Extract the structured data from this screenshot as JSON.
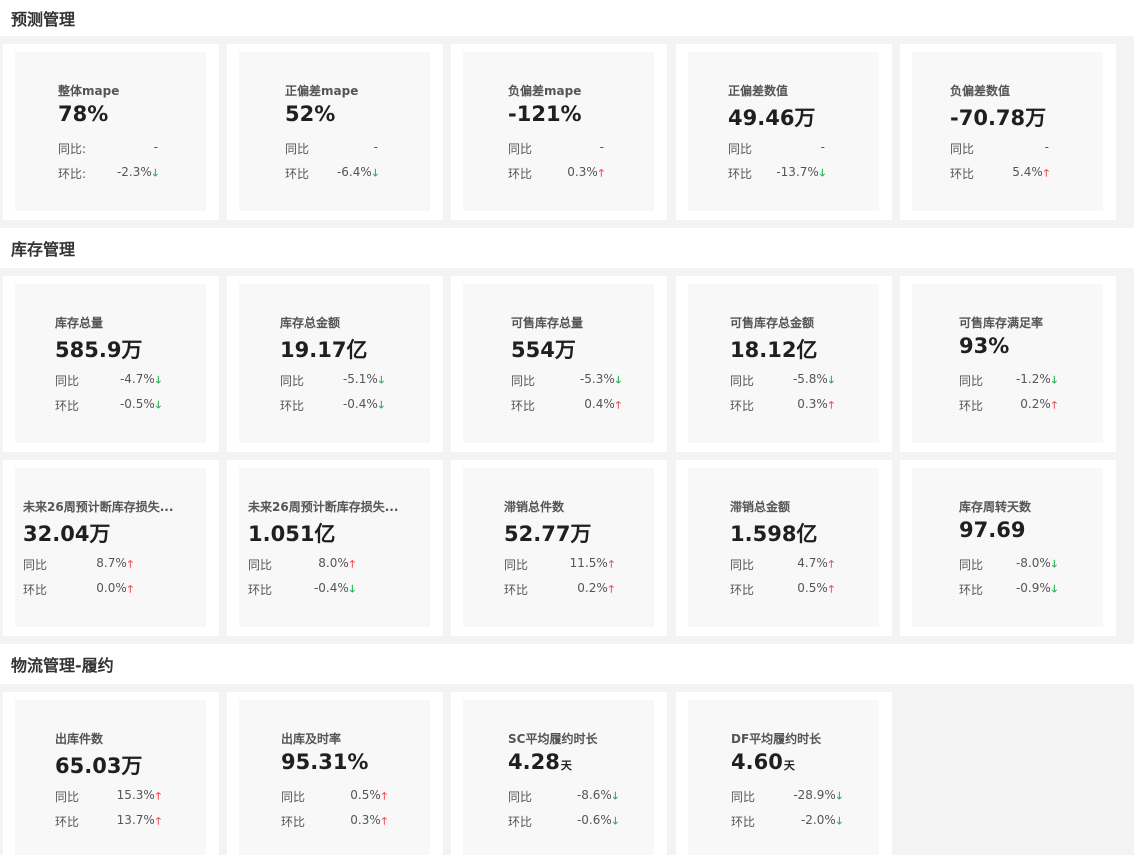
{
  "sections": {
    "forecast": {
      "title": "预测管理"
    },
    "inventory": {
      "title": "库存管理"
    },
    "logistics": {
      "title": "物流管理-履约"
    }
  },
  "cards": [
    {
      "title": "整体mape",
      "value": "78%",
      "unit": "",
      "yoy_label": "同比:",
      "yoy": "-",
      "yoy_dir": "",
      "mom_label": "环比:",
      "mom": "-2.3%",
      "mom_dir": "down"
    },
    {
      "title": "正偏差mape",
      "value": "52%",
      "unit": "",
      "yoy_label": "同比",
      "yoy": "-",
      "yoy_dir": "",
      "mom_label": "环比",
      "mom": "-6.4%",
      "mom_dir": "down"
    },
    {
      "title": "负偏差mape",
      "value": "-121%",
      "unit": "",
      "yoy_label": "同比",
      "yoy": "-",
      "yoy_dir": "",
      "mom_label": "环比",
      "mom": "0.3%",
      "mom_dir": "up"
    },
    {
      "title": "正偏差数值",
      "value": "49.46万",
      "unit": "",
      "yoy_label": "同比",
      "yoy": "-",
      "yoy_dir": "",
      "mom_label": "环比",
      "mom": "-13.7%",
      "mom_dir": "down"
    },
    {
      "title": "负偏差数值",
      "value": "-70.78万",
      "unit": "",
      "yoy_label": "同比",
      "yoy": "-",
      "yoy_dir": "",
      "mom_label": "环比",
      "mom": "5.4%",
      "mom_dir": "up"
    },
    {
      "title": "库存总量",
      "value": "585.9万",
      "unit": "",
      "yoy_label": "同比",
      "yoy": "-4.7%",
      "yoy_dir": "down",
      "mom_label": "环比",
      "mom": "-0.5%",
      "mom_dir": "down"
    },
    {
      "title": "库存总金额",
      "value": "19.17亿",
      "unit": "",
      "yoy_label": "同比",
      "yoy": "-5.1%",
      "yoy_dir": "down",
      "mom_label": "环比",
      "mom": "-0.4%",
      "mom_dir": "down"
    },
    {
      "title": "可售库存总量",
      "value": "554万",
      "unit": "",
      "yoy_label": "同比",
      "yoy": "-5.3%",
      "yoy_dir": "down",
      "mom_label": "环比",
      "mom": "0.4%",
      "mom_dir": "up"
    },
    {
      "title": "可售库存总金额",
      "value": "18.12亿",
      "unit": "",
      "yoy_label": "同比",
      "yoy": "-5.8%",
      "yoy_dir": "down",
      "mom_label": "环比",
      "mom": "0.3%",
      "mom_dir": "up"
    },
    {
      "title": "可售库存满足率",
      "value": "93%",
      "unit": "",
      "yoy_label": "同比",
      "yoy": "-1.2%",
      "yoy_dir": "down",
      "mom_label": "环比",
      "mom": "0.2%",
      "mom_dir": "up"
    },
    {
      "title": "未来26周预计断库存损失...",
      "value": "32.04万",
      "unit": "",
      "yoy_label": "同比",
      "yoy": "8.7%",
      "yoy_dir": "up",
      "mom_label": "环比",
      "mom": "0.0%",
      "mom_dir": "up"
    },
    {
      "title": "未来26周预计断库存损失...",
      "value": "1.051亿",
      "unit": "",
      "yoy_label": "同比",
      "yoy": "8.0%",
      "yoy_dir": "up",
      "mom_label": "环比",
      "mom": "-0.4%",
      "mom_dir": "down"
    },
    {
      "title": "滞销总件数",
      "value": "52.77万",
      "unit": "",
      "yoy_label": "同比",
      "yoy": "11.5%",
      "yoy_dir": "up",
      "mom_label": "环比",
      "mom": "0.2%",
      "mom_dir": "up"
    },
    {
      "title": "滞销总金额",
      "value": "1.598亿",
      "unit": "",
      "yoy_label": "同比",
      "yoy": "4.7%",
      "yoy_dir": "up",
      "mom_label": "环比",
      "mom": "0.5%",
      "mom_dir": "up"
    },
    {
      "title": "库存周转天数",
      "value": "97.69",
      "unit": "",
      "yoy_label": "同比",
      "yoy": "-8.0%",
      "yoy_dir": "down",
      "mom_label": "环比",
      "mom": "-0.9%",
      "mom_dir": "down"
    },
    {
      "title": "出库件数",
      "value": "65.03万",
      "unit": "",
      "yoy_label": "同比",
      "yoy": "15.3%",
      "yoy_dir": "up",
      "mom_label": "环比",
      "mom": "13.7%",
      "mom_dir": "up"
    },
    {
      "title": "出库及时率",
      "value": "95.31%",
      "unit": "",
      "yoy_label": "同比",
      "yoy": "0.5%",
      "yoy_dir": "up",
      "mom_label": "环比",
      "mom": "0.3%",
      "mom_dir": "up"
    },
    {
      "title": "SC平均履约时长",
      "value": "4.28",
      "unit": "天",
      "yoy_label": "同比",
      "yoy": "-8.6%",
      "yoy_dir": "down",
      "mom_label": "环比",
      "mom": "-0.6%",
      "mom_dir": "down"
    },
    {
      "title": "DF平均履约时长",
      "value": "4.60",
      "unit": "天",
      "yoy_label": "同比",
      "yoy": "-28.9%",
      "yoy_dir": "down",
      "mom_label": "环比",
      "mom": "-2.0%",
      "mom_dir": "down"
    }
  ],
  "colors": {
    "up": "#f2505b",
    "down": "#1fae4e"
  },
  "icons": {
    "up": "arrow-up-icon",
    "down": "arrow-down-icon"
  }
}
